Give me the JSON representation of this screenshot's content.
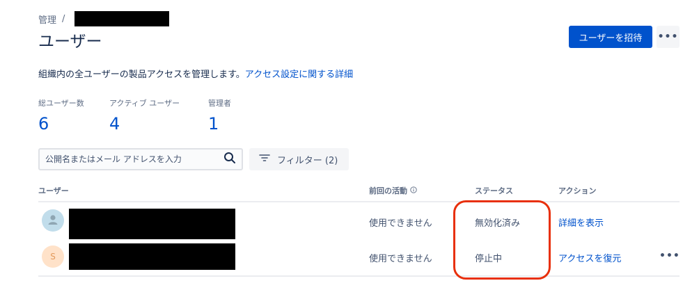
{
  "breadcrumb": {
    "root": "管理",
    "separator": "/"
  },
  "page": {
    "title": "ユーザー"
  },
  "header": {
    "invite_label": "ユーザーを招待",
    "more_label": "•••"
  },
  "description": {
    "text": "組織内の全ユーザーの製品アクセスを管理します。",
    "link": "アクセス設定に関する詳細"
  },
  "stats": [
    {
      "label": "総ユーザー数",
      "value": "6"
    },
    {
      "label": "アクティブ ユーザー",
      "value": "4"
    },
    {
      "label": "管理者",
      "value": "1"
    }
  ],
  "search": {
    "placeholder": "公開名またはメール アドレスを入力",
    "value": ""
  },
  "filter": {
    "label": "フィルター (2)"
  },
  "table": {
    "headers": {
      "user": "ユーザー",
      "last_activity": "前回の活動",
      "status": "ステータス",
      "action": "アクション"
    },
    "rows": [
      {
        "avatar_initial": "",
        "last_activity": "使用できません",
        "status": "無効化済み",
        "action": "詳細を表示",
        "more": ""
      },
      {
        "avatar_initial": "S",
        "last_activity": "使用できません",
        "status": "停止中",
        "action": "アクセスを復元",
        "more": "•••"
      }
    ]
  },
  "colors": {
    "primary": "#0052CC",
    "highlight": "#E8300C",
    "redaction": "#000000"
  },
  "icons": [
    "search-icon",
    "filter-icon",
    "info-icon",
    "more-icon",
    "avatar-placeholder-icon"
  ]
}
